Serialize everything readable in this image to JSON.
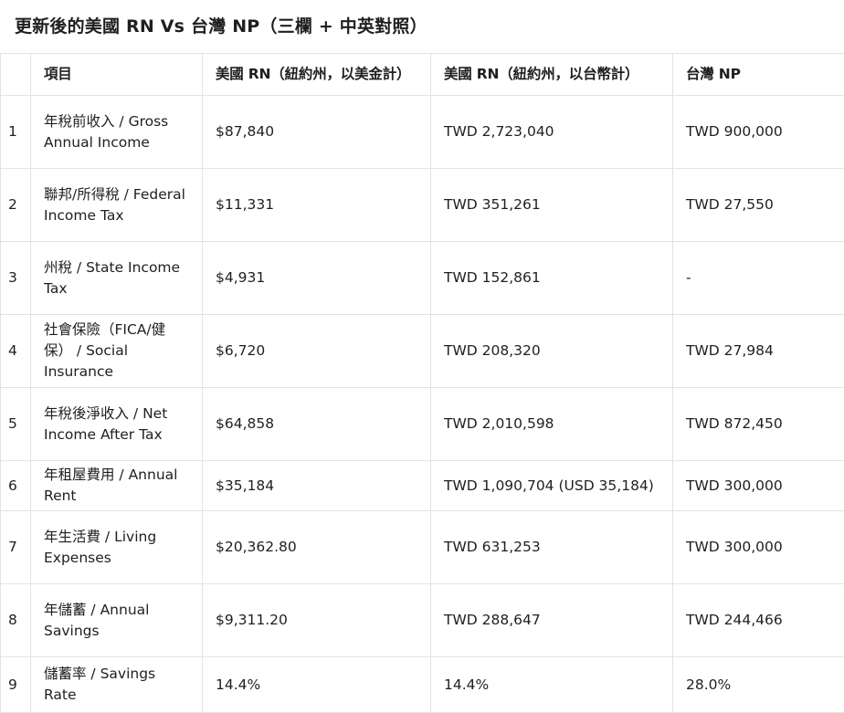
{
  "title": "更新後的美國 RN Vs 台灣 NP（三欄 + 中英對照）",
  "table": {
    "headers": [
      "",
      "項目",
      "美國 RN（紐約州，以美金計）",
      "美國 RN（紐約州，以台幣計）",
      "台灣 NP"
    ],
    "rows": [
      {
        "idx": "1",
        "item": "年稅前收入 / Gross Annual Income",
        "usd": "$87,840",
        "twd": "TWD 2,723,040",
        "tw_np": "TWD 900,000"
      },
      {
        "idx": "2",
        "item": "聯邦/所得稅 / Federal Income Tax",
        "usd": "$11,331",
        "twd": "TWD 351,261",
        "tw_np": "TWD 27,550"
      },
      {
        "idx": "3",
        "item": "州稅 / State Income Tax",
        "usd": "$4,931",
        "twd": "TWD 152,861",
        "tw_np": "-"
      },
      {
        "idx": "4",
        "item": "社會保險（FICA/健保） / Social Insurance",
        "usd": "$6,720",
        "twd": "TWD 208,320",
        "tw_np": "TWD 27,984"
      },
      {
        "idx": "5",
        "item": "年稅後淨收入 / Net Income After Tax",
        "usd": "$64,858",
        "twd": "TWD 2,010,598",
        "tw_np": "TWD 872,450"
      },
      {
        "idx": "6",
        "item": "年租屋費用 / Annual Rent",
        "usd": "$35,184",
        "twd": "TWD 1,090,704 (USD 35,184)",
        "tw_np": "TWD 300,000"
      },
      {
        "idx": "7",
        "item": "年生活費 / Living Expenses",
        "usd": "$20,362.80",
        "twd": "TWD 631,253",
        "tw_np": "TWD 300,000"
      },
      {
        "idx": "8",
        "item": "年儲蓄 / Annual Savings",
        "usd": "$9,311.20",
        "twd": "TWD 288,647",
        "tw_np": "TWD 244,466"
      },
      {
        "idx": "9",
        "item": "儲蓄率 / Savings Rate",
        "usd": "14.4%",
        "twd": "14.4%",
        "tw_np": "28.0%"
      }
    ]
  }
}
